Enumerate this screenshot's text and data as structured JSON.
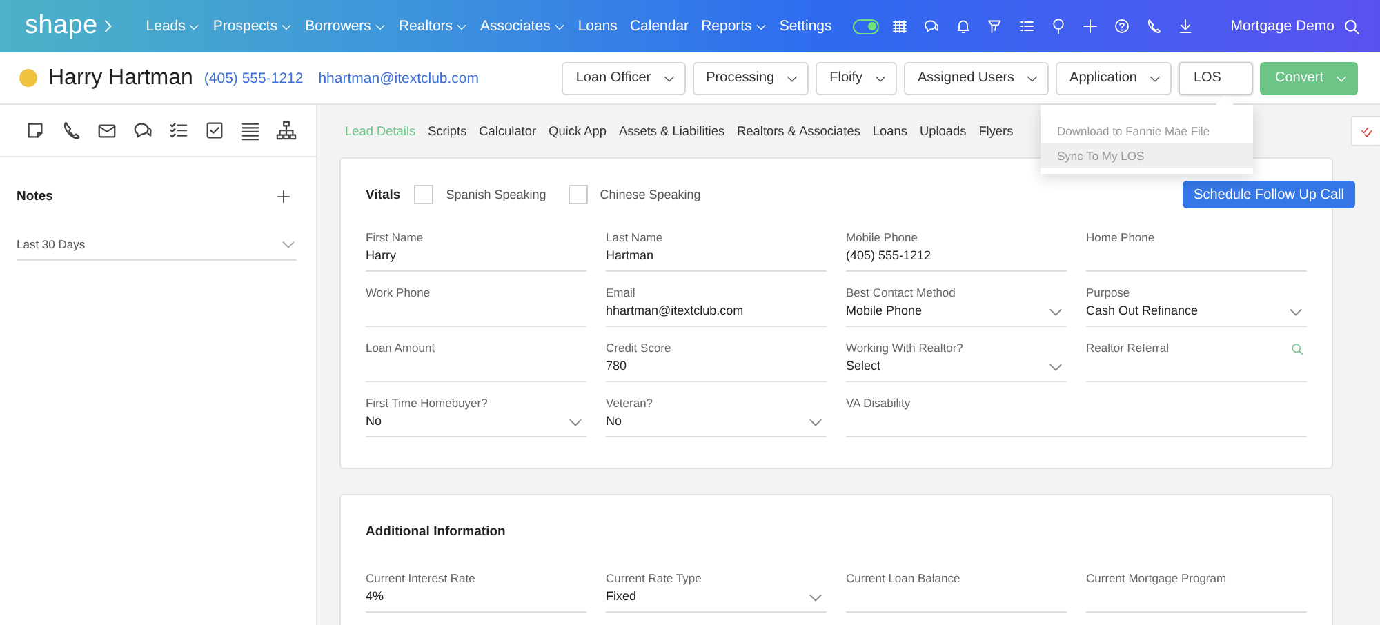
{
  "nav": {
    "logo": "shape",
    "links": [
      {
        "label": "Leads",
        "dropdown": true
      },
      {
        "label": "Prospects",
        "dropdown": true
      },
      {
        "label": "Borrowers",
        "dropdown": true
      },
      {
        "label": "Realtors",
        "dropdown": true
      },
      {
        "label": "Associates",
        "dropdown": true
      },
      {
        "label": "Loans",
        "dropdown": false
      },
      {
        "label": "Calendar",
        "dropdown": false
      },
      {
        "label": "Reports",
        "dropdown": true
      },
      {
        "label": "Settings",
        "dropdown": false
      }
    ],
    "toggle": {
      "on": true
    },
    "account": "Mortgage Demo"
  },
  "lead": {
    "name": "Harry Hartman",
    "phone": "(405) 555-1212",
    "email": "hhartman@itextclub.com",
    "buttons": [
      {
        "label": "Loan Officer",
        "kind": "dropdown",
        "expanded": false
      },
      {
        "label": "Processing",
        "kind": "dropdown",
        "expanded": false
      },
      {
        "label": "Floify",
        "kind": "dropdown",
        "expanded": false
      },
      {
        "label": "Assigned Users",
        "kind": "dropdown",
        "expanded": false
      },
      {
        "label": "Application",
        "kind": "dropdown",
        "expanded": false
      },
      {
        "label": "LOS",
        "kind": "plain",
        "expanded": true
      },
      {
        "label": "Convert",
        "kind": "primary",
        "expanded": false
      }
    ],
    "menu": [
      {
        "label": "Download to Fannie Mae File",
        "selected": false
      },
      {
        "label": "Sync To My LOS",
        "selected": true
      }
    ]
  },
  "sidebar": {
    "notes_title": "Notes",
    "filter": "Last 30 Days"
  },
  "tabs": [
    {
      "label": "Lead Details",
      "selected": true
    },
    {
      "label": "Scripts",
      "selected": false
    },
    {
      "label": "Calculator",
      "selected": false
    },
    {
      "label": "Quick App",
      "selected": false
    },
    {
      "label": "Assets & Liabilities",
      "selected": false
    },
    {
      "label": "Realtors & Associates",
      "selected": false
    },
    {
      "label": "Loans",
      "selected": false
    },
    {
      "label": "Uploads",
      "selected": false
    },
    {
      "label": "Flyers",
      "selected": false
    }
  ],
  "vitals": {
    "title": "Vitals",
    "checkboxes": [
      {
        "label": "Spanish Speaking",
        "checked": false
      },
      {
        "label": "Chinese Speaking",
        "checked": false
      }
    ],
    "button": "Schedule Follow Up Call",
    "fields": [
      {
        "label": "First Name",
        "value": "Harry",
        "kind": "text"
      },
      {
        "label": "Last Name",
        "value": "Hartman",
        "kind": "text"
      },
      {
        "label": "Mobile Phone",
        "value": "(405) 555-1212",
        "kind": "text"
      },
      {
        "label": "Home Phone",
        "kind": "text"
      },
      {
        "label": "Work Phone",
        "kind": "text"
      },
      {
        "label": "Email",
        "value": "hhartman@itextclub.com",
        "kind": "text"
      },
      {
        "label": "Best Contact Method",
        "value": "Mobile Phone",
        "kind": "select"
      },
      {
        "label": "Purpose",
        "value": "Cash Out Refinance",
        "kind": "select"
      },
      {
        "label": "Loan Amount",
        "kind": "text"
      },
      {
        "label": "Credit Score",
        "value": "780",
        "kind": "text"
      },
      {
        "label": "Working With Realtor?",
        "value": "Select",
        "kind": "select"
      },
      {
        "label": "Realtor Referral",
        "kind": "search"
      },
      {
        "label": "First Time Homebuyer?",
        "value": "No",
        "kind": "select"
      },
      {
        "label": "Veteran?",
        "value": "No",
        "kind": "select"
      },
      {
        "label": "VA Disability",
        "kind": "wide"
      }
    ]
  },
  "additional": {
    "title": "Additional Information",
    "fields": [
      {
        "label": "Current Interest Rate",
        "value": "4%",
        "kind": "text"
      },
      {
        "label": "Current Rate Type",
        "value": "Fixed",
        "kind": "select"
      },
      {
        "label": "Current Loan Balance",
        "kind": "text"
      },
      {
        "label": "Current Mortgage Program",
        "kind": "text"
      }
    ]
  }
}
